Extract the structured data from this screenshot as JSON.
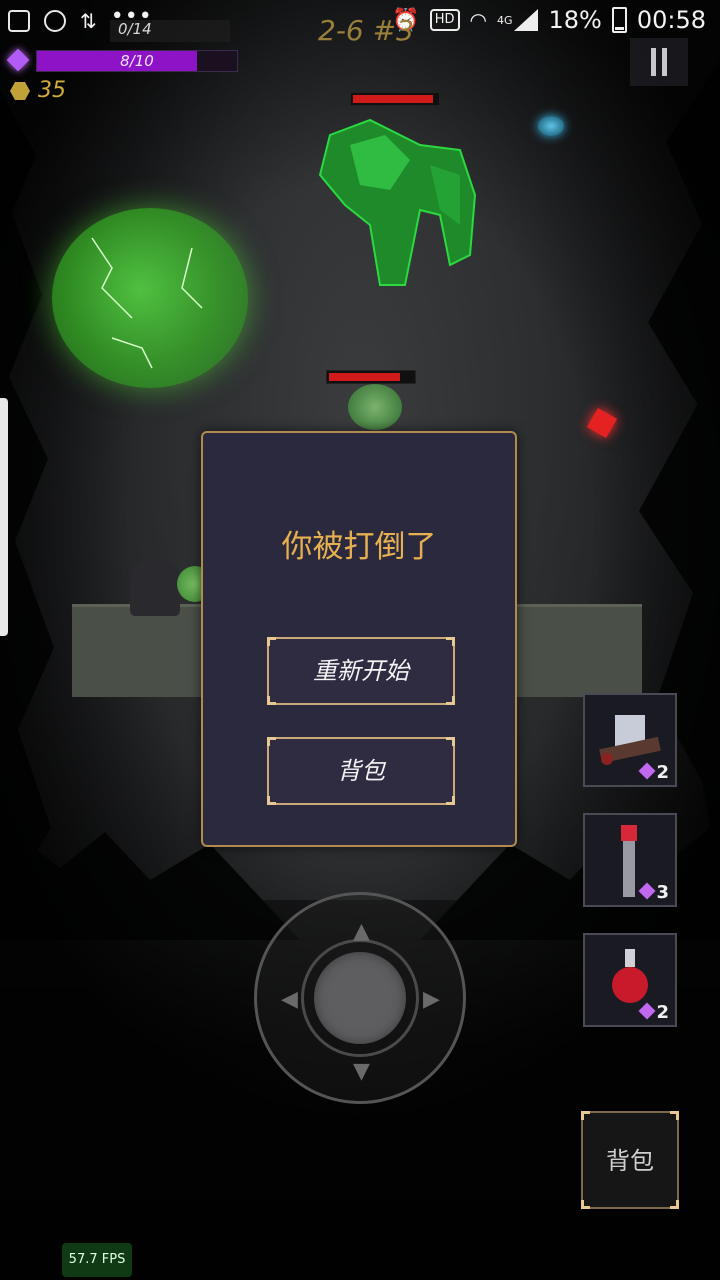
{
  "status_bar": {
    "battery_percent": "18%",
    "time": "00:58",
    "hd_label": "HD",
    "network_label": "4G",
    "icons": [
      "gallery-icon",
      "game-icon",
      "transfer-icon",
      "more-dots-icon",
      "alarm-icon",
      "wifi-icon",
      "signal-icon",
      "battery-icon"
    ]
  },
  "hud": {
    "xp_text": "0/14",
    "level_label": "2-6 #3",
    "mana_text": "8/10",
    "mana_fraction": 0.8,
    "coins": "35"
  },
  "enemies": [
    {
      "name": "golem",
      "hp_fraction": 0.95
    },
    {
      "name": "toad",
      "hp_fraction": 0.85
    }
  ],
  "dialog": {
    "title": "你被打倒了",
    "restart_label": "重新开始",
    "bag_label": "背包"
  },
  "items": [
    {
      "name": "cart-item-icon",
      "count": "2"
    },
    {
      "name": "lantern-pole-item-icon",
      "count": "3"
    },
    {
      "name": "red-potion-item-icon",
      "count": "2"
    }
  ],
  "bag_button_label": "背包",
  "fps_label": "57.7 FPS",
  "colors": {
    "mana": "#8e12c6",
    "coin": "#d2ad3b",
    "dialog_border": "#b08a4f",
    "dialog_title": "#e6b050",
    "enemy_hp": "#d11a1a"
  }
}
